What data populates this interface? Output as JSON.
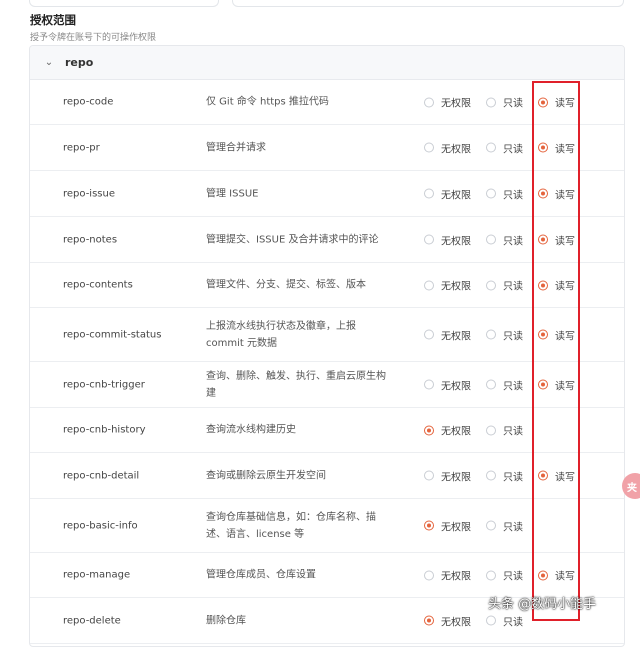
{
  "scope": {
    "title": "授权范围",
    "description": "授予令牌在账号下的可操作权限"
  },
  "group": {
    "name": "repo",
    "expanded": true
  },
  "options": {
    "none": "无权限",
    "read": "只读",
    "write": "读写"
  },
  "accent_color": "#e4633c",
  "rows": [
    {
      "name": "repo-code",
      "desc": "仅 Git 命令 https 推拉代码",
      "selected": "write"
    },
    {
      "name": "repo-pr",
      "desc": "管理合并请求",
      "selected": "write"
    },
    {
      "name": "repo-issue",
      "desc": "管理 ISSUE",
      "selected": "write"
    },
    {
      "name": "repo-notes",
      "desc": "管理提交、ISSUE 及合并请求中的评论",
      "selected": "write"
    },
    {
      "name": "repo-contents",
      "desc": "管理文件、分支、提交、标签、版本",
      "selected": "write"
    },
    {
      "name": "repo-commit-status",
      "desc": "上报流水线执行状态及徽章，上报 commit 元数据",
      "selected": "write"
    },
    {
      "name": "repo-cnb-trigger",
      "desc": "查询、删除、触发、执行、重启云原生构建",
      "selected": "write"
    },
    {
      "name": "repo-cnb-history",
      "desc": "查询流水线构建历史",
      "selected": "none",
      "no_write": true
    },
    {
      "name": "repo-cnb-detail",
      "desc": "查询或删除云原生开发空间",
      "selected": "write"
    },
    {
      "name": "repo-basic-info",
      "desc": "查询仓库基础信息，如：仓库名称、描述、语言、license 等",
      "selected": "none",
      "no_write": true
    },
    {
      "name": "repo-manage",
      "desc": "管理仓库成员、仓库设置",
      "selected": "write"
    },
    {
      "name": "repo-delete",
      "desc": "删除仓库",
      "selected": "none",
      "no_write": true
    }
  ],
  "side_badge": "夹",
  "watermark": "头条 @数码小能手"
}
